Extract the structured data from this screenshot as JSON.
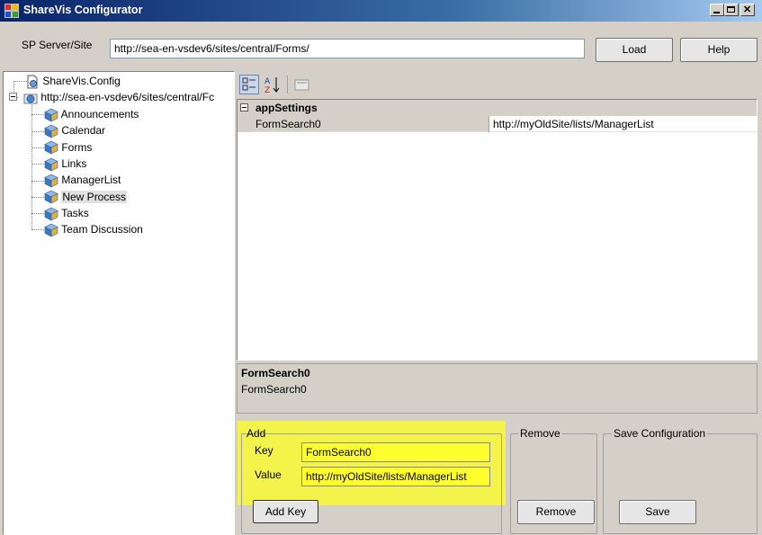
{
  "window": {
    "title": "ShareVis Configurator"
  },
  "toolbar": {
    "server_label": "SP Server/Site",
    "server_value": "http://sea-en-vsdev6/sites/central/Forms/",
    "load_label": "Load",
    "help_label": "Help"
  },
  "tree": {
    "root_config": "ShareVis.Config",
    "root_site": "http://sea-en-vsdev6/sites/central/Fc",
    "items": [
      "Announcements",
      "Calendar",
      "Forms",
      "Links",
      "ManagerList",
      "New Process",
      "Tasks",
      "Team Discussion"
    ],
    "selected": "New Process"
  },
  "grid": {
    "category": "appSettings",
    "row_name": "FormSearch0",
    "row_value": "http://myOldSite/lists/ManagerList"
  },
  "description": {
    "title": "FormSearch0",
    "text": "FormSearch0"
  },
  "add_group": {
    "label": "Add",
    "key_label": "Key",
    "key_value": "FormSearch0",
    "value_label": "Value",
    "value_value": "http://myOldSite/lists/ManagerList",
    "button": "Add Key"
  },
  "remove_group": {
    "label": "Remove",
    "button": "Remove"
  },
  "save_group": {
    "label": "Save Configuration",
    "button": "Save"
  },
  "colors": {
    "highlight": "#ffff00",
    "titlebar": "#0a246a",
    "selection": "#e1e1e1"
  }
}
